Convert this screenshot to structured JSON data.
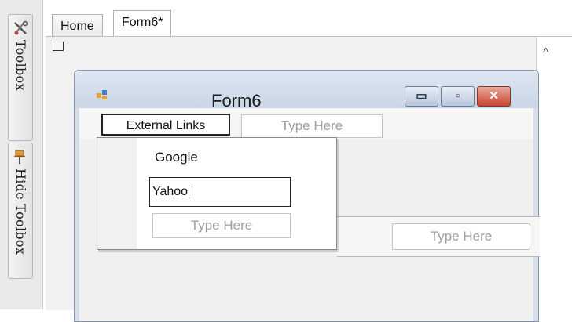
{
  "toolbox": {
    "tab1_label": "Toolbox",
    "tab2_label": "Hide Toolbox"
  },
  "doc_tabs": [
    {
      "label": "Home"
    },
    {
      "label": "Form6*"
    }
  ],
  "form": {
    "title": "Form6",
    "minimize": "▭",
    "maximize": "▫",
    "close": "✕"
  },
  "menu": {
    "external_links": "External Links",
    "type_here": "Type Here"
  },
  "dropdown": {
    "google": "Google",
    "yahoo": "Yahoo",
    "type_here": "Type Here"
  },
  "strip2": {
    "type_here": "Type Here"
  },
  "scroll": {
    "up_glyph": "^"
  }
}
